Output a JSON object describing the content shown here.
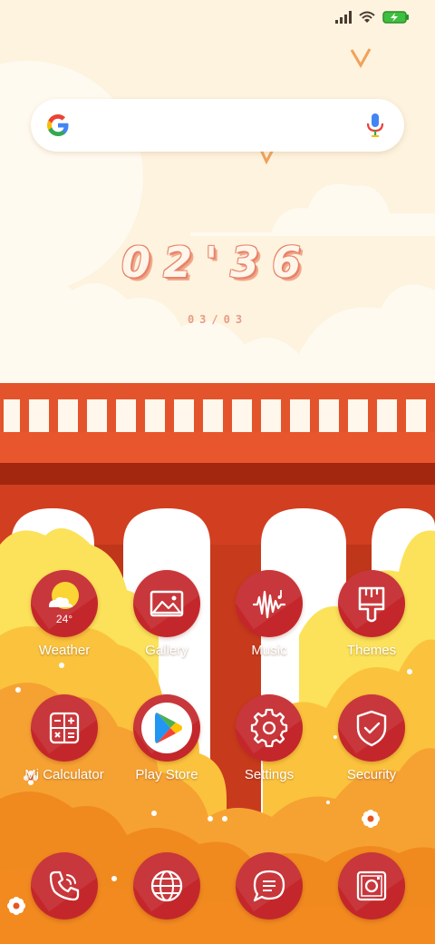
{
  "clock": {
    "time": "02'36",
    "date": "03/03"
  },
  "search": {
    "engine_icon": "google-g-icon",
    "voice_icon": "mic-icon"
  },
  "status": {
    "icons": [
      "signal-icon",
      "wifi-icon",
      "battery-charging-icon"
    ]
  },
  "apps": {
    "row1": [
      {
        "label": "Weather",
        "icon": "weather-icon",
        "temp": "24°"
      },
      {
        "label": "Gallery",
        "icon": "gallery-icon"
      },
      {
        "label": "Music",
        "icon": "music-icon"
      },
      {
        "label": "Themes",
        "icon": "themes-brush-icon"
      }
    ],
    "row2": [
      {
        "label": "Mi Calculator",
        "icon": "calculator-icon"
      },
      {
        "label": "Play Store",
        "icon": "play-store-icon"
      },
      {
        "label": "Settings",
        "icon": "gear-icon"
      },
      {
        "label": "Security",
        "icon": "shield-check-icon"
      }
    ],
    "dock": [
      {
        "icon": "phone-icon"
      },
      {
        "icon": "browser-globe-icon"
      },
      {
        "icon": "messages-icon"
      },
      {
        "icon": "camera-icon"
      }
    ]
  },
  "colors": {
    "sky": "#fdf2dc",
    "bridge_red": "#d83e22",
    "icon_red": "#c4272b",
    "foliage_orange": "#f6a233",
    "foliage_yellow": "#fbe25a"
  }
}
